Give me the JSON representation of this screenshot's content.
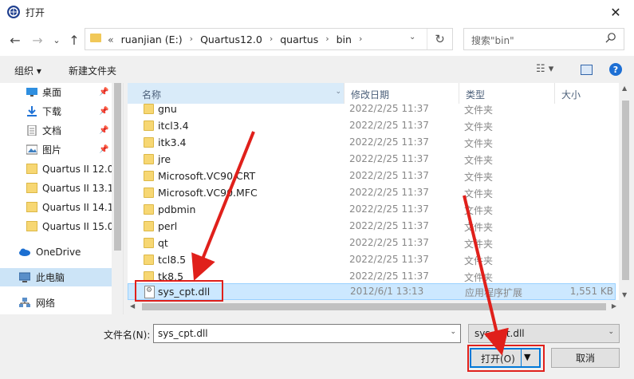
{
  "window": {
    "title": "打开",
    "close_glyph": "✕"
  },
  "nav": {
    "back_glyph": "←",
    "forward_glyph": "→",
    "recent_glyph": "⌄",
    "up_glyph": "↑",
    "refresh_glyph": "↻",
    "address_prefix": "«",
    "breadcrumbs": [
      "ruanjian (E:)",
      "Quartus12.0",
      "quartus",
      "bin"
    ],
    "search_placeholder": "搜索\"bin\""
  },
  "toolbar": {
    "organize": "组织 ▾",
    "new_folder": "新建文件夹",
    "help": "?"
  },
  "sidebar": {
    "items": [
      {
        "label": "桌面",
        "icon": "desktop-icon",
        "pinned": true
      },
      {
        "label": "下载",
        "icon": "download-icon",
        "pinned": true
      },
      {
        "label": "文档",
        "icon": "document-icon",
        "pinned": true
      },
      {
        "label": "图片",
        "icon": "picture-icon",
        "pinned": true
      },
      {
        "label": "Quartus II 12.0",
        "icon": "folder-icon",
        "pinned": false
      },
      {
        "label": "Quartus II 13.1",
        "icon": "folder-icon",
        "pinned": false
      },
      {
        "label": "Quartus II 14.1",
        "icon": "folder-icon",
        "pinned": false
      },
      {
        "label": "Quartus II 15.0",
        "icon": "folder-icon",
        "pinned": false
      },
      {
        "label": "OneDrive",
        "icon": "cloud-icon",
        "pinned": false
      },
      {
        "label": "此电脑",
        "icon": "computer-icon",
        "pinned": false,
        "selected": true
      },
      {
        "label": "网络",
        "icon": "network-icon",
        "pinned": false
      }
    ],
    "pin_glyph": "📌"
  },
  "columns": {
    "name": "名称",
    "date": "修改日期",
    "type": "类型",
    "size": "大小"
  },
  "files": [
    {
      "name": "gnu",
      "date": "2022/2/25 11:37",
      "type": "文件夹",
      "size": "",
      "kind": "folder"
    },
    {
      "name": "itcl3.4",
      "date": "2022/2/25 11:37",
      "type": "文件夹",
      "size": "",
      "kind": "folder"
    },
    {
      "name": "itk3.4",
      "date": "2022/2/25 11:37",
      "type": "文件夹",
      "size": "",
      "kind": "folder"
    },
    {
      "name": "jre",
      "date": "2022/2/25 11:37",
      "type": "文件夹",
      "size": "",
      "kind": "folder"
    },
    {
      "name": "Microsoft.VC90.CRT",
      "date": "2022/2/25 11:37",
      "type": "文件夹",
      "size": "",
      "kind": "folder"
    },
    {
      "name": "Microsoft.VC90.MFC",
      "date": "2022/2/25 11:37",
      "type": "文件夹",
      "size": "",
      "kind": "folder"
    },
    {
      "name": "pdbmin",
      "date": "2022/2/25 11:37",
      "type": "文件夹",
      "size": "",
      "kind": "folder"
    },
    {
      "name": "perl",
      "date": "2022/2/25 11:37",
      "type": "文件夹",
      "size": "",
      "kind": "folder"
    },
    {
      "name": "qt",
      "date": "2022/2/25 11:37",
      "type": "文件夹",
      "size": "",
      "kind": "folder"
    },
    {
      "name": "tcl8.5",
      "date": "2022/2/25 11:37",
      "type": "文件夹",
      "size": "",
      "kind": "folder"
    },
    {
      "name": "tk8.5",
      "date": "2022/2/25 11:37",
      "type": "文件夹",
      "size": "",
      "kind": "folder"
    },
    {
      "name": "sys_cpt.dll",
      "date": "2012/6/1 13:13",
      "type": "应用程序扩展",
      "size": "1,551 KB",
      "kind": "dll",
      "selected": true
    }
  ],
  "bottom": {
    "filename_label": "文件名(N):",
    "filename_value": "sys_cpt.dll",
    "filetype_value": "sys_cpt.dll",
    "open_label": "打开(O)",
    "cancel_label": "取消"
  },
  "annotation_color": "#e0201b"
}
